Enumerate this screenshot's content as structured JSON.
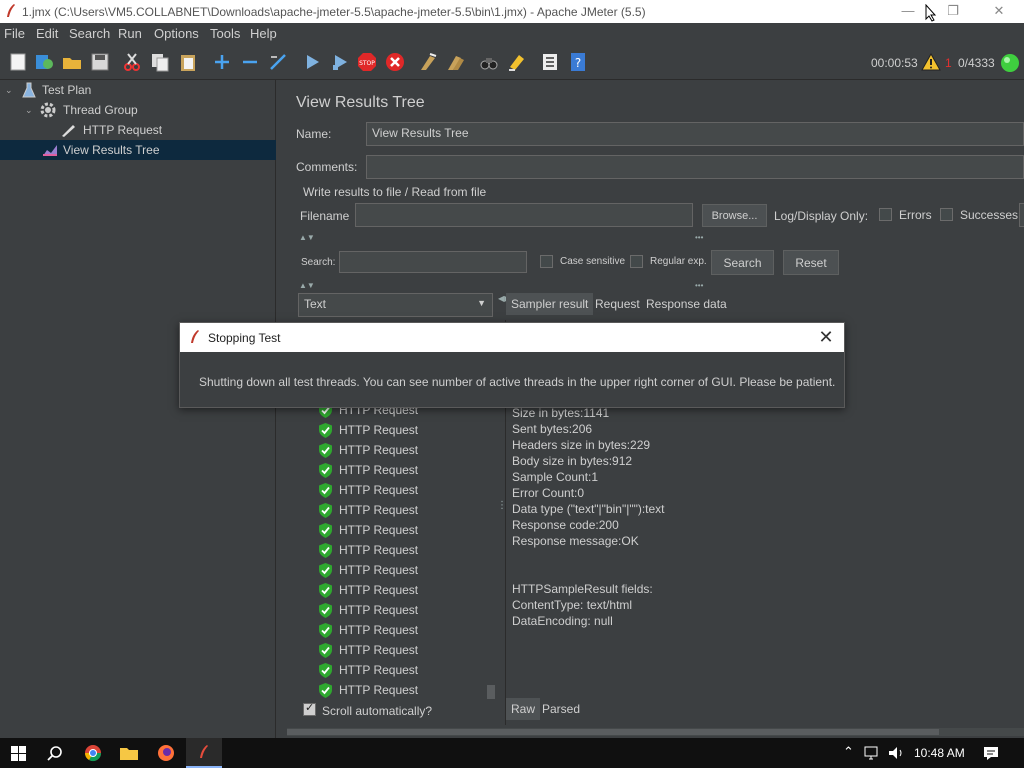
{
  "window": {
    "title": "1.jmx (C:\\Users\\VM5.COLLABNET\\Downloads\\apache-jmeter-5.5\\apache-jmeter-5.5\\bin\\1.jmx) - Apache JMeter (5.5)",
    "minimize": "—",
    "maximize": "❐",
    "close": "✕"
  },
  "menu": [
    "File",
    "Edit",
    "Search",
    "Run",
    "Options",
    "Tools",
    "Help"
  ],
  "toolbar": {
    "elapsed": "00:00:53",
    "threads": "0/4333",
    "error_count": "1"
  },
  "tree": {
    "test_plan": "Test Plan",
    "thread_group": "Thread Group",
    "http_request": "HTTP Request",
    "view_results_tree": "View Results Tree"
  },
  "panel": {
    "heading": "View Results Tree",
    "name_label": "Name:",
    "name_value": "View Results Tree",
    "comments_label": "Comments:",
    "comments_value": "",
    "write_results_legend": "Write results to file / Read from file",
    "filename_label": "Filename",
    "filename_value": "",
    "browse_label": "Browse...",
    "log_display_label": "Log/Display Only:",
    "errors_label": "Errors",
    "successes_label": "Successes",
    "search_label": "Search:",
    "search_value": "",
    "case_sensitive_label": "Case sensitive",
    "regular_exp_label": "Regular exp.",
    "search_button": "Search",
    "reset_button": "Reset",
    "renderer_value": "Text",
    "tabs": [
      "Sampler result",
      "Request",
      "Response data"
    ],
    "samples": [
      "HTTP Request",
      "HTTP Request",
      "HTTP Request",
      "HTTP Request",
      "HTTP Request",
      "HTTP Request",
      "HTTP Request",
      "HTTP Request",
      "HTTP Request",
      "HTTP Request",
      "HTTP Request",
      "HTTP Request",
      "HTTP Request",
      "HTTP Request",
      "HTTP Request"
    ],
    "result_lines": [
      "Size in bytes:1141",
      "Sent bytes:206",
      "Headers size in bytes:229",
      "Body size in bytes:912",
      "Sample Count:1",
      "Error Count:0",
      "Data type (\"text\"|\"bin\"|\"\"):text",
      "Response code:200",
      "Response message:OK",
      "",
      "",
      "HTTPSampleResult fields:",
      "ContentType: text/html",
      "DataEncoding: null"
    ],
    "scroll_auto_label": "Scroll automatically?",
    "raw_tab": "Raw",
    "parsed_tab": "Parsed"
  },
  "dialog": {
    "title": "Stopping Test",
    "message": "Shutting down all test threads. You can see number of active threads in the upper right corner of GUI. Please be patient.",
    "close": "✕"
  },
  "taskbar": {
    "clock": "10:48 AM"
  }
}
